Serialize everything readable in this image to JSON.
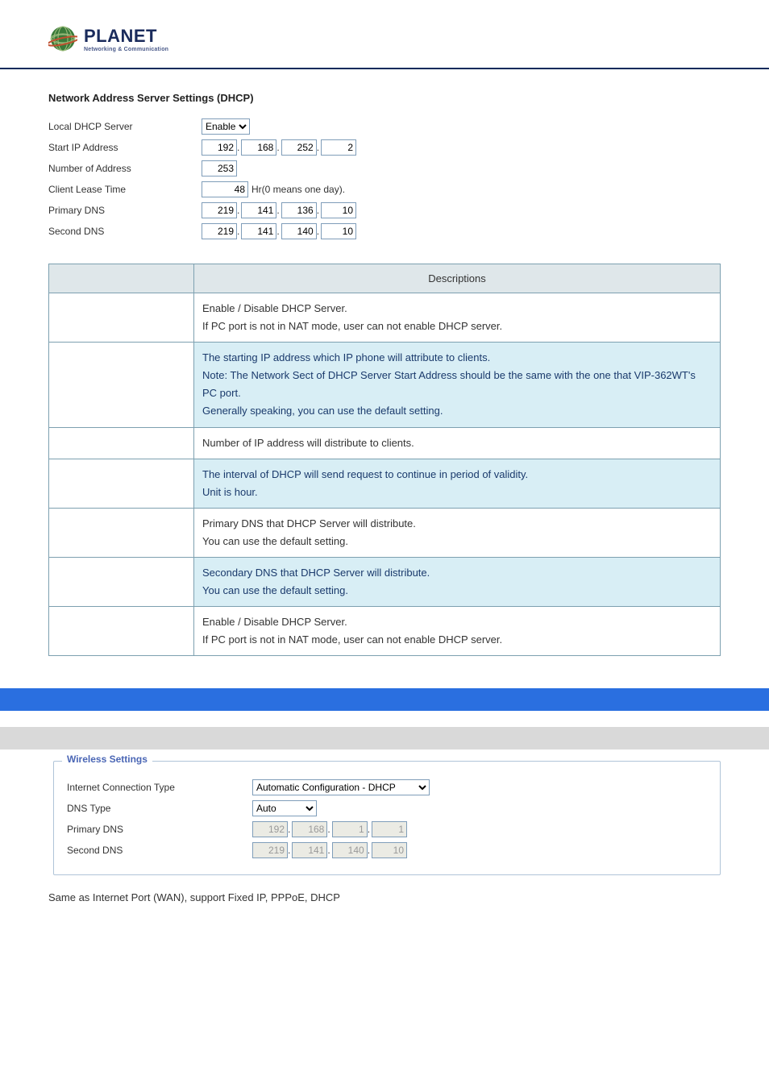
{
  "logo": {
    "planet": "PLANET",
    "sub": "Networking & Communication"
  },
  "dhcp_title": "Network Address Server Settings (DHCP)",
  "dhcp": {
    "local_label": "Local DHCP Server",
    "local_value": "Enable",
    "start_label": "Start IP Address",
    "start_ip": [
      "192",
      "168",
      "252",
      "2"
    ],
    "num_label": "Number of Address",
    "num_value": "253",
    "lease_label": "Client Lease Time",
    "lease_value": "48",
    "lease_suffix": "Hr(0 means one day).",
    "pdns_label": "Primary DNS",
    "pdns": [
      "219",
      "141",
      "136",
      "10"
    ],
    "sdns_label": "Second DNS",
    "sdns": [
      "219",
      "141",
      "140",
      "10"
    ]
  },
  "table": {
    "header": "Descriptions",
    "rows": [
      {
        "alt": false,
        "text": "Enable / Disable DHCP Server.\nIf PC port is not in NAT mode, user can not enable DHCP server."
      },
      {
        "alt": true,
        "text": "The starting IP address which IP phone will attribute to clients.\nNote: The Network Sect of DHCP Server Start Address should be the same with the one that VIP-362WT's PC port.\nGenerally speaking, you can use the default setting."
      },
      {
        "alt": false,
        "text": "Number of IP address will distribute to clients."
      },
      {
        "alt": true,
        "text": "The interval of DHCP will send request to continue in period of validity.\nUnit is hour."
      },
      {
        "alt": false,
        "text": "Primary DNS that DHCP Server will distribute.\nYou can use the default setting."
      },
      {
        "alt": true,
        "text": "Secondary DNS that DHCP Server will distribute.\nYou can use the default setting."
      },
      {
        "alt": false,
        "text": "Enable / Disable DHCP Server.\nIf PC port is not in NAT mode, user can not enable DHCP server."
      }
    ]
  },
  "wireless": {
    "legend": "Wireless Settings",
    "ict_label": "Internet Connection Type",
    "ict_value": "Automatic Configuration - DHCP",
    "dns_type_label": "DNS Type",
    "dns_type_value": "Auto",
    "pdns_label": "Primary DNS",
    "pdns": [
      "192",
      "168",
      "1",
      "1"
    ],
    "sdns_label": "Second DNS",
    "sdns": [
      "219",
      "141",
      "140",
      "10"
    ]
  },
  "footnote": "Same as Internet Port (WAN), support Fixed IP, PPPoE, DHCP"
}
